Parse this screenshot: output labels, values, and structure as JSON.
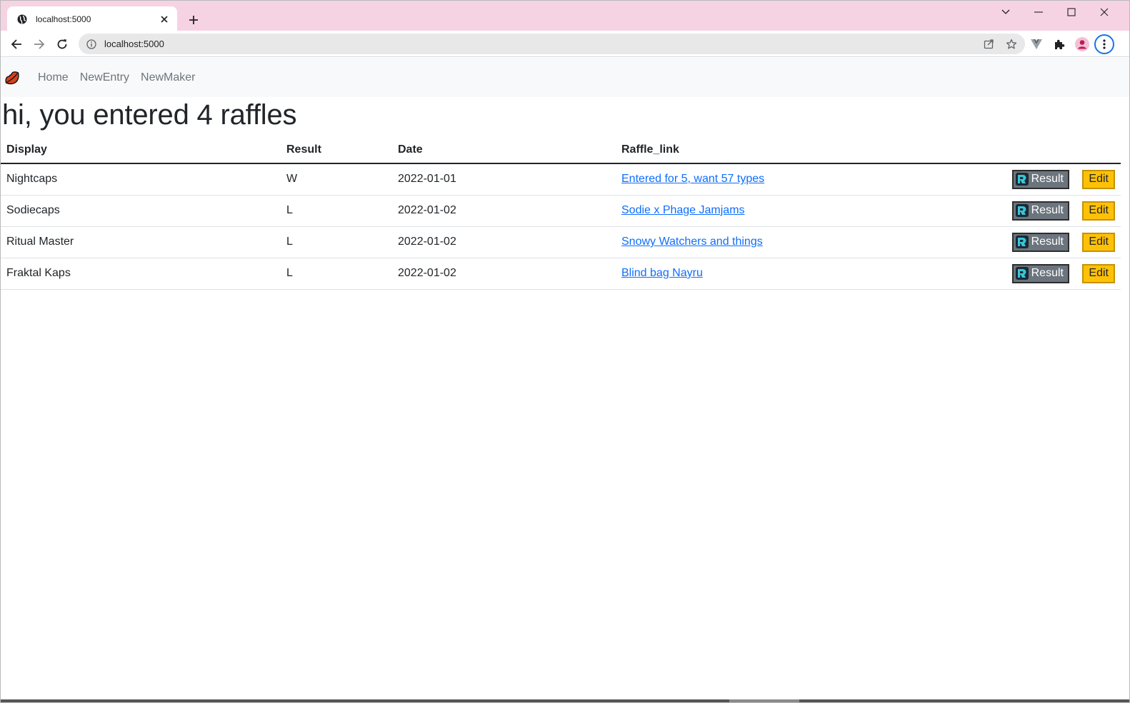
{
  "browser": {
    "tab_title": "localhost:5000",
    "url": "localhost:5000"
  },
  "nav": {
    "links": [
      "Home",
      "NewEntry",
      "NewMaker"
    ]
  },
  "heading": "hi, you entered 4 raffles",
  "table": {
    "headers": [
      "Display",
      "Result",
      "Date",
      "Raffle_link"
    ],
    "rows": [
      {
        "display": "Nightcaps",
        "result": "W",
        "date": "2022-01-01",
        "link": "Entered for 5, want 57 types"
      },
      {
        "display": "Sodiecaps",
        "result": "L",
        "date": "2022-01-02",
        "link": "Sodie x Phage Jamjams"
      },
      {
        "display": "Ritual Master",
        "result": "L",
        "date": "2022-01-02",
        "link": "Snowy Watchers and things"
      },
      {
        "display": "Fraktal Kaps",
        "result": "L",
        "date": "2022-01-02",
        "link": "Blind bag Nayru"
      }
    ],
    "result_button_label": "Result",
    "edit_button_label": "Edit"
  },
  "colors": {
    "tabstrip": "#f6d3e3",
    "link": "#0d6efd",
    "result_button": "#6c757d",
    "edit_button": "#ffc107",
    "brand_lips": "#d9411e"
  },
  "icons": {
    "tab_favicon": "globe-icon",
    "brand": "lips-icon",
    "result_logo": "discord-style-logo-icon"
  }
}
